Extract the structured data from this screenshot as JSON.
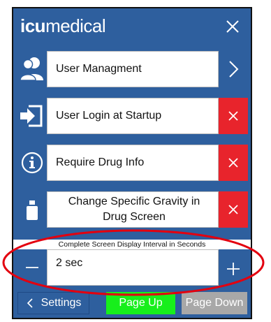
{
  "app": {
    "logo_bold": "icu",
    "logo_light": "medical"
  },
  "settings_rows": [
    {
      "icon": "users-icon",
      "label": "User Managment",
      "action": "chevron-right-icon"
    },
    {
      "icon": "login-icon",
      "label": "User Login at Startup",
      "action": "close-icon"
    },
    {
      "icon": "info-icon",
      "label": "Require Drug Info",
      "action": "close-icon"
    },
    {
      "icon": "vial-icon",
      "label_line1": "Change Specific Gravity in",
      "label_line2": "Drug Screen",
      "action": "close-icon"
    }
  ],
  "interval": {
    "caption": "Complete Screen Display Interval in Seconds",
    "value": "2 sec"
  },
  "footer": {
    "settings_label": "Settings",
    "page_up_label": "Page Up",
    "page_down_label": "Page Down"
  },
  "colors": {
    "brand_blue": "#2e5f9e",
    "toggle_off_red": "#e8242c",
    "page_up_green": "#17ef1c",
    "page_down_gray": "#a8a8a8",
    "annotation_red": "#e3000f"
  }
}
